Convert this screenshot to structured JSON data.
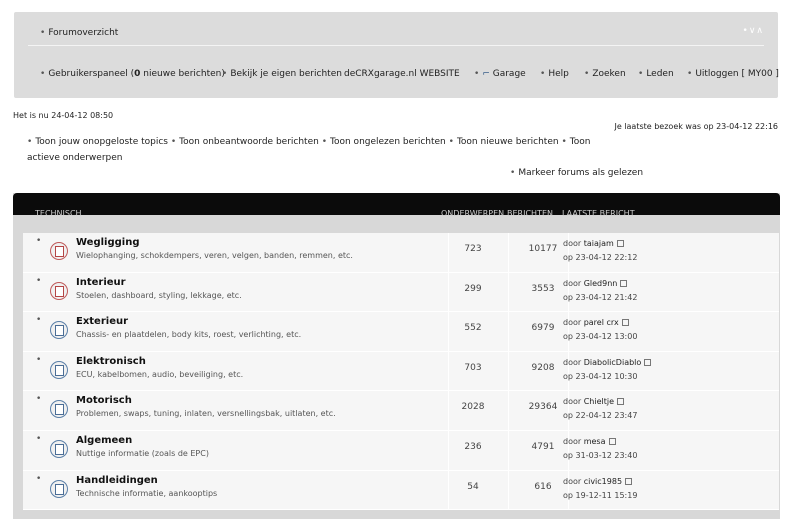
{
  "nav": {
    "overview": "Forumoverzicht",
    "control_panel_prefix": "Gebruikerspaneel (",
    "new_count": "0",
    "control_panel_suffix": " nieuwe berichten)",
    "own_posts": "Bekijk je eigen berichten",
    "website": "deCRXgarage.nl WEBSITE",
    "garage": "Garage",
    "help": "Help",
    "search": "Zoeken",
    "members": "Leden",
    "logout": "Uitloggen [ MY00 ]"
  },
  "info": {
    "time_now": "Het is nu 24-04-12 08:50",
    "last_visit": "Je laatste bezoek was op 23-04-12 22:16",
    "quick_links": [
      "Toon jouw onopgeloste topics",
      "Toon onbeantwoorde berichten",
      "Toon ongelezen berichten",
      "Toon nieuwe berichten",
      "Toon actieve onderwerpen"
    ],
    "mark_read": "Markeer forums als gelezen"
  },
  "forum_header": {
    "category": "TECHNISCH",
    "topics": "ONDERWERPEN",
    "posts": "BERICHTEN",
    "last_post": "LAATSTE BERICHT"
  },
  "forums": [
    {
      "title": "Wegligging",
      "desc": "Wielophanging, schokdempers, veren, velgen, banden, remmen, etc.",
      "topics": "723",
      "posts": "10177",
      "by": "door",
      "user": "taiajam",
      "date": "op 23-04-12 22:12",
      "status": "unread"
    },
    {
      "title": "Interieur",
      "desc": "Stoelen, dashboard, styling, lekkage, etc.",
      "topics": "299",
      "posts": "3553",
      "by": "door",
      "user": "Gled9nn",
      "date": "op 23-04-12 21:42",
      "status": "unread"
    },
    {
      "title": "Exterieur",
      "desc": "Chassis- en plaatdelen, body kits, roest, verlichting, etc.",
      "topics": "552",
      "posts": "6979",
      "by": "door",
      "user": "parel crx",
      "date": "op 23-04-12 13:00",
      "status": "read"
    },
    {
      "title": "Elektronisch",
      "desc": "ECU, kabelbomen, audio, beveiliging, etc.",
      "topics": "703",
      "posts": "9208",
      "by": "door",
      "user": "DiabolicDiablo",
      "date": "op 23-04-12 10:30",
      "status": "read"
    },
    {
      "title": "Motorisch",
      "desc": "Problemen, swaps, tuning, inlaten, versnellingsbak, uitlaten, etc.",
      "topics": "2028",
      "posts": "29364",
      "by": "door",
      "user": "Chieltje",
      "date": "op 22-04-12 23:47",
      "status": "read"
    },
    {
      "title": "Algemeen",
      "desc": "Nuttige informatie (zoals de EPC)",
      "topics": "236",
      "posts": "4791",
      "by": "door",
      "user": "mesa",
      "date": "op 31-03-12 23:40",
      "status": "read"
    },
    {
      "title": "Handleidingen",
      "desc": "Technische informatie, aankooptips",
      "topics": "54",
      "posts": "616",
      "by": "door",
      "user": "civic1985",
      "date": "op 19-12-11 15:19",
      "status": "read"
    }
  ]
}
